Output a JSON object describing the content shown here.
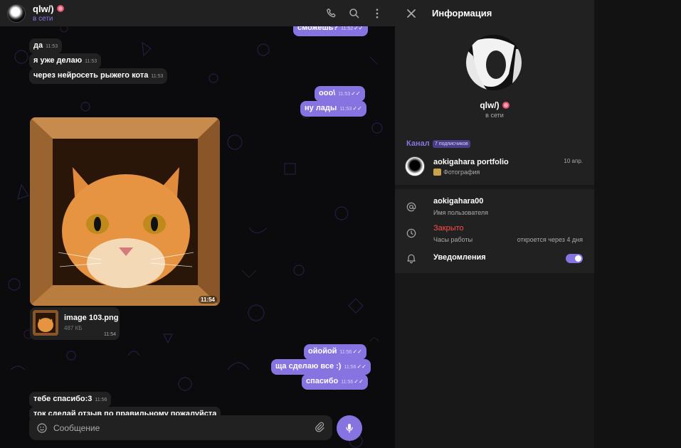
{
  "chat": {
    "name": "qlw/)",
    "status": "в сети",
    "composer_placeholder": "Сообщение",
    "messages": [
      {
        "dir": "out",
        "text": "сможешь?",
        "time": "11:52"
      },
      {
        "dir": "in",
        "text": "да",
        "time": "11:53"
      },
      {
        "dir": "in",
        "text": "я уже делаю",
        "time": "11:53"
      },
      {
        "dir": "in",
        "text": "через нейросеть рыжего кота",
        "time": "11:53"
      },
      {
        "dir": "out",
        "text": "ооо\\",
        "time": "11:53"
      },
      {
        "dir": "out",
        "text": "ну лады",
        "time": "11:53"
      },
      {
        "dir": "out",
        "text": "ойойой",
        "time": "11:56"
      },
      {
        "dir": "out",
        "text": "ща сделаю все :)",
        "time": "11:56"
      },
      {
        "dir": "out",
        "text": "спасибо",
        "time": "11:56"
      },
      {
        "dir": "in",
        "text": "тебе спасибо:3",
        "time": "11:56"
      },
      {
        "dir": "in",
        "text": "ток сделай отзыв по правильному пожалуйста",
        "time": ""
      }
    ],
    "photo_time": "11:54",
    "file": {
      "name": "image 103.png",
      "size": "487 КБ",
      "time": "11:54"
    }
  },
  "info": {
    "title": "Информация",
    "name": "qlw/)",
    "status": "в сети",
    "channel_label": "Канал",
    "subscribers": "7 подписчиков",
    "channel": {
      "name": "aokigahara portfolio",
      "category": "Фотография",
      "date": "10 апр."
    },
    "username": {
      "value": "aokigahara00",
      "label": "Имя пользователя"
    },
    "hours": {
      "value": "Закрыто",
      "label": "Часы работы",
      "note": "откроется через 4 дня"
    },
    "notifications": {
      "label": "Уведомления",
      "enabled": true
    }
  },
  "colors": {
    "accent": "#8774e1",
    "closed": "#ff4d4d",
    "bubble_in": "#212121"
  }
}
